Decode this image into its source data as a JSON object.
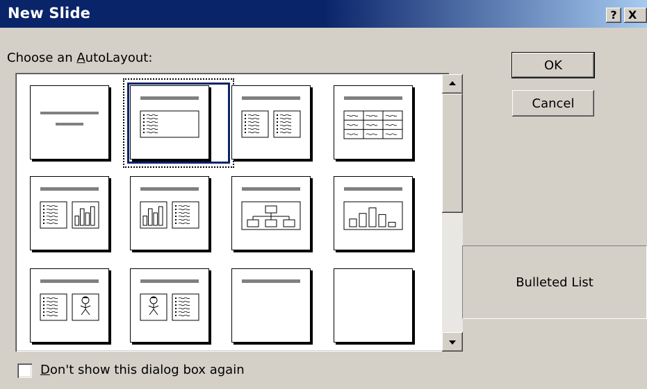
{
  "window": {
    "title": "New Slide",
    "help_button": "?",
    "close_button": "X"
  },
  "prompt": {
    "prefix": "Choose an ",
    "accel": "A",
    "rest": "utoLayout:"
  },
  "layouts": [
    {
      "name": "Title Slide",
      "icon": "title-slide-icon"
    },
    {
      "name": "Bulleted List",
      "icon": "bulleted-list-icon",
      "selected": true
    },
    {
      "name": "2 Column Text",
      "icon": "two-column-text-icon"
    },
    {
      "name": "Table",
      "icon": "table-icon"
    },
    {
      "name": "Text & Chart",
      "icon": "text-chart-icon"
    },
    {
      "name": "Chart & Text",
      "icon": "chart-text-icon"
    },
    {
      "name": "Organization Chart",
      "icon": "org-chart-icon"
    },
    {
      "name": "Chart",
      "icon": "chart-icon"
    },
    {
      "name": "Text & Clip Art",
      "icon": "text-clipart-icon"
    },
    {
      "name": "Clip Art & Text",
      "icon": "clipart-text-icon"
    },
    {
      "name": "Title Only",
      "icon": "title-only-icon"
    },
    {
      "name": "Blank",
      "icon": "blank-icon"
    }
  ],
  "buttons": {
    "ok": "OK",
    "cancel": "Cancel"
  },
  "preview": {
    "label": "Bulleted List"
  },
  "checkbox": {
    "accel": "D",
    "rest": "on't show this dialog box again",
    "checked": false
  },
  "colors": {
    "title_bar": "#0a246a",
    "face": "#d4d0c8",
    "selection": "#0a246a"
  }
}
